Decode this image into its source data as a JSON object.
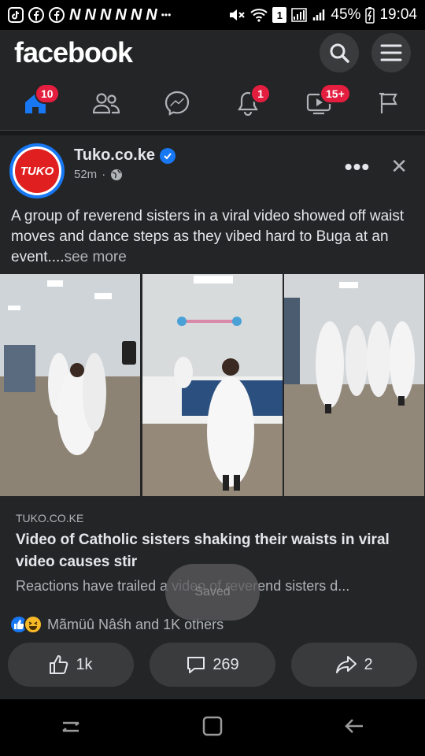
{
  "status_bar": {
    "n_icons": [
      "N",
      "N",
      "N",
      "N",
      "N",
      "N"
    ],
    "ellipsis": "•••",
    "sim_label": "1",
    "battery": "45%",
    "time": "19:04"
  },
  "header": {
    "logo": "facebook"
  },
  "nav": {
    "home_badge": "10",
    "notifications_badge": "1",
    "watch_badge": "15+"
  },
  "post": {
    "page_name": "Tuko.co.ke",
    "avatar_text": "TUKO",
    "time": "52m",
    "time_separator": "·",
    "caption": "A group of reverend sisters in a viral video showed off waist moves and dance steps as they vibed hard to Buga at an event....",
    "see_more": "see more",
    "more_menu": "•••",
    "close": "✕"
  },
  "link": {
    "domain": "TUKO.CO.KE",
    "title": "Video of Catholic sisters shaking their waists in viral video causes stir",
    "description": "Reactions have trailed a video of reverend sisters d..."
  },
  "toast": {
    "text": "Saved"
  },
  "reactions": {
    "text": "Mãmüû Nâśh and 1K others"
  },
  "actions": {
    "like_count": "1k",
    "comment_count": "269",
    "share_count": "2"
  },
  "colors": {
    "background": "#242526",
    "accent": "#1877f2",
    "badge": "#e41e3f",
    "button": "#3a3b3c"
  }
}
